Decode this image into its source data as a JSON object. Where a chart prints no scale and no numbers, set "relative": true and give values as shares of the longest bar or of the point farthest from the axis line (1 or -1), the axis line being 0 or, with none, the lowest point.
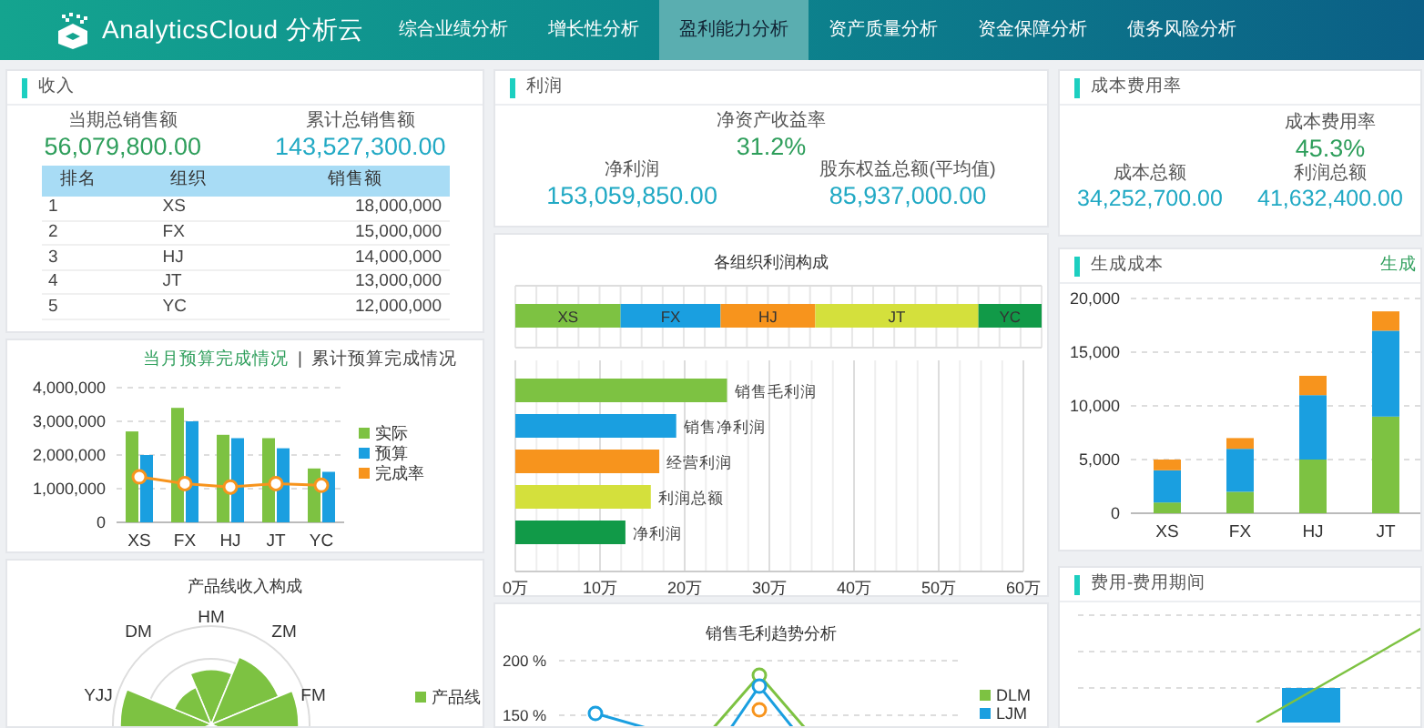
{
  "navbar": {
    "logo_text": "AnalyticsCloud 分析云",
    "items": [
      {
        "label": "综合业绩分析",
        "selected": false
      },
      {
        "label": "增长性分析",
        "selected": false
      },
      {
        "label": "盈利能力分析",
        "selected": true
      },
      {
        "label": "资产质量分析",
        "selected": false
      },
      {
        "label": "资金保障分析",
        "selected": false
      },
      {
        "label": "债务风险分析",
        "selected": false
      }
    ]
  },
  "income": {
    "title": "收入",
    "kpis": [
      {
        "label": "当期总销售额",
        "value": "56,079,800.00",
        "color": "#2e9e5b"
      },
      {
        "label": "累计总销售额",
        "value": "143,527,300.00",
        "color": "#21a9c4"
      }
    ],
    "table": {
      "columns": [
        "排名",
        "组织",
        "销售额"
      ],
      "rows": [
        [
          "1",
          "XS",
          "18,000,000"
        ],
        [
          "2",
          "FX",
          "15,000,000"
        ],
        [
          "3",
          "HJ",
          "14,000,000"
        ],
        [
          "4",
          "JT",
          "13,000,000"
        ],
        [
          "5",
          "YC",
          "12,000,000"
        ]
      ]
    }
  },
  "budget": {
    "tabs": [
      {
        "label": "当月预算完成情况",
        "selected": true
      },
      {
        "label": "累计预算完成情况",
        "selected": false
      }
    ],
    "separator": "|",
    "chart_data": {
      "type": "bar",
      "stacked": false,
      "grid": true,
      "legend": true,
      "categories": [
        "XS",
        "FX",
        "HJ",
        "JT",
        "YC"
      ],
      "ylim": [
        0,
        4000000
      ],
      "yticks": [
        {
          "value": 0,
          "label": "0"
        },
        {
          "value": 1000000,
          "label": "1,000,000"
        },
        {
          "value": 2000000,
          "label": "2,000,000"
        },
        {
          "value": 3000000,
          "label": "3,000,000"
        },
        {
          "value": 4000000,
          "label": "4,000,000"
        }
      ],
      "series": [
        {
          "name": "实际",
          "color": "#7dc242",
          "type": "bar",
          "values": [
            2700000,
            3400000,
            2600000,
            2500000,
            1600000
          ]
        },
        {
          "name": "预算",
          "color": "#1a9fe0",
          "type": "bar",
          "values": [
            2000000,
            3000000,
            2500000,
            2200000,
            1500000
          ]
        },
        {
          "name": "完成率",
          "color": "#f7941d",
          "type": "line",
          "marker": "circle",
          "values": [
            1350000,
            1150000,
            1050000,
            1150000,
            1100000
          ]
        }
      ]
    }
  },
  "product_line": {
    "title": "产品线收入构成",
    "axis_labels": [
      "HM",
      "ZM",
      "FM",
      "YJJ",
      "DM"
    ],
    "legend": [
      {
        "name": "产品线",
        "color": "#7dc242"
      }
    ]
  },
  "profit": {
    "title": "利润",
    "main_kpi": {
      "label": "净资产收益率",
      "value": "31.2%"
    },
    "kpis": [
      {
        "label": "净利润",
        "value": "153,059,850.00"
      },
      {
        "label": "股东权益总额(平均值)",
        "value": "85,937,000.00"
      }
    ]
  },
  "composition": {
    "title": "各组织利润构成",
    "share_bar": {
      "chart_data": {
        "type": "bar",
        "orientation": "horizontal",
        "stacked": true,
        "relative": true,
        "grid": true,
        "series": [
          {
            "name": "XS",
            "color": "#7dc242",
            "values": [
              0.2
            ]
          },
          {
            "name": "FX",
            "color": "#1a9fe0",
            "values": [
              0.19
            ]
          },
          {
            "name": "HJ",
            "color": "#f7941d",
            "values": [
              0.18
            ]
          },
          {
            "name": "JT",
            "color": "#d4e03c",
            "values": [
              0.31
            ]
          },
          {
            "name": "YC",
            "color": "#119a48",
            "values": [
              0.12
            ]
          }
        ]
      }
    },
    "profit_bars": {
      "chart_data": {
        "type": "bar",
        "orientation": "horizontal",
        "grid": true,
        "categories": [
          "销售毛利润",
          "销售净利润",
          "经营利润",
          "利润总额",
          "净利润"
        ],
        "values": [
          25,
          19,
          17,
          16,
          13
        ],
        "colors": [
          "#7dc242",
          "#1a9fe0",
          "#f7941d",
          "#d4e03c",
          "#119a48"
        ],
        "xlim": [
          0,
          60
        ],
        "xticks": [
          {
            "value": 0,
            "label": "0万"
          },
          {
            "value": 10,
            "label": "10万"
          },
          {
            "value": 20,
            "label": "20万"
          },
          {
            "value": 30,
            "label": "30万"
          },
          {
            "value": 40,
            "label": "40万"
          },
          {
            "value": 50,
            "label": "50万"
          },
          {
            "value": 60,
            "label": "60万"
          }
        ]
      }
    }
  },
  "trend": {
    "title": "销售毛利趋势分析",
    "y_tick_labels": [
      "200 %",
      "150 %"
    ],
    "legend": [
      {
        "name": "DLM",
        "color": "#7dc242"
      },
      {
        "name": "LJM",
        "color": "#1a9fe0"
      }
    ]
  },
  "cost_ratio": {
    "title": "成本费用率",
    "main_kpi": {
      "label": "成本费用率",
      "value": "45.3%"
    },
    "kpis": [
      {
        "label": "成本总额",
        "value": "34,252,700.00"
      },
      {
        "label": "利润总额",
        "value": "41,632,400.00"
      }
    ]
  },
  "production_cost": {
    "title": "生成成本",
    "link": "生成",
    "chart_data": {
      "type": "bar",
      "stacked": true,
      "grid": true,
      "categories": [
        "XS",
        "FX",
        "HJ",
        "JT"
      ],
      "ylim": [
        0,
        20000
      ],
      "yticks": [
        {
          "value": 0,
          "label": "0"
        },
        {
          "value": 5000,
          "label": "5,000"
        },
        {
          "value": 10000,
          "label": "10,000"
        },
        {
          "value": 15000,
          "label": "15,000"
        },
        {
          "value": 20000,
          "label": "20,000"
        }
      ],
      "series": [
        {
          "color": "#7dc242",
          "values": [
            1000,
            2000,
            5000,
            9000
          ]
        },
        {
          "color": "#1a9fe0",
          "values": [
            3000,
            4000,
            6000,
            8000
          ]
        },
        {
          "color": "#f7941d",
          "values": [
            1000,
            1000,
            1800,
            1800
          ]
        }
      ]
    }
  },
  "expense_period": {
    "title": "费用-费用期间"
  }
}
